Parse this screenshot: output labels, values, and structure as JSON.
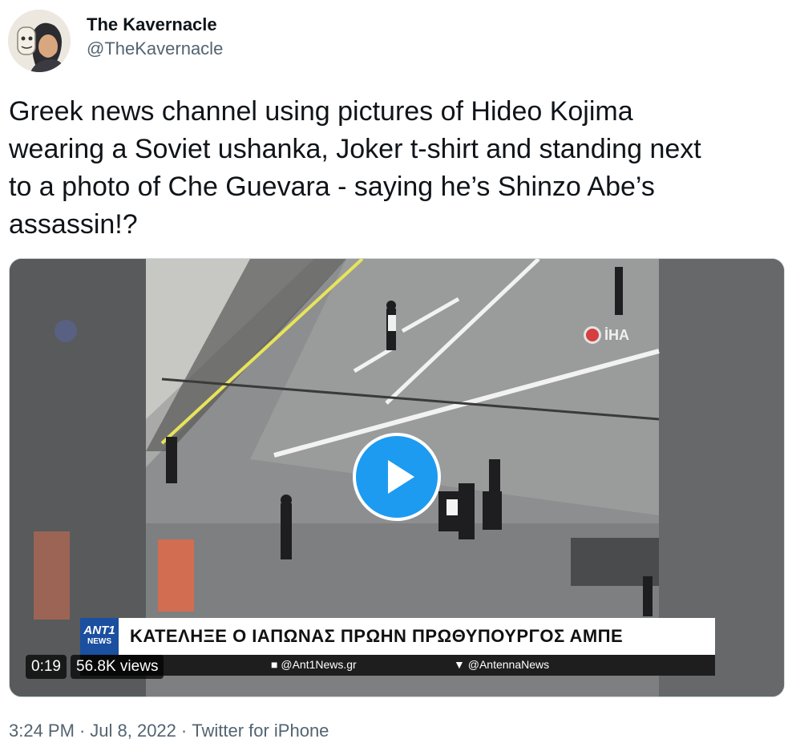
{
  "author": {
    "display_name": "The Kavernacle",
    "handle": "@TheKavernacle"
  },
  "tweet": {
    "text": "Greek news channel using pictures of Hideo Kojima\nwearing a Soviet ushanka, Joker t-shirt and standing next\nto a photo of Che Guevara - saying he’s Shinzo Abe’s\nassassin!?"
  },
  "video": {
    "duration": "0:19",
    "views": "56.8K views",
    "watermark": "İHA",
    "news_logo_top": "ANT1",
    "news_logo_bottom": "NEWS",
    "headline": "ΚΑΤΕΛΗΞΕ Ο ΙΑΠΩΝΑΣ ΠΡΩΗΝ ΠΡΩΘΥΠΟΥΡΓΟΣ ΑΜΠΕ",
    "social_facebook": "@Ant1News.gr",
    "social_twitter": "@AntennaNews"
  },
  "meta": {
    "time": "3:24 PM",
    "date": "Jul 8, 2022",
    "source": "Twitter for iPhone"
  },
  "colors": {
    "accent": "#1d9bf0",
    "secondary_text": "#536471",
    "ant1_blue": "#1b4fa0"
  },
  "icons": [
    "play-icon",
    "facebook-icon",
    "twitter-bird-icon",
    "iha-logo-icon"
  ]
}
